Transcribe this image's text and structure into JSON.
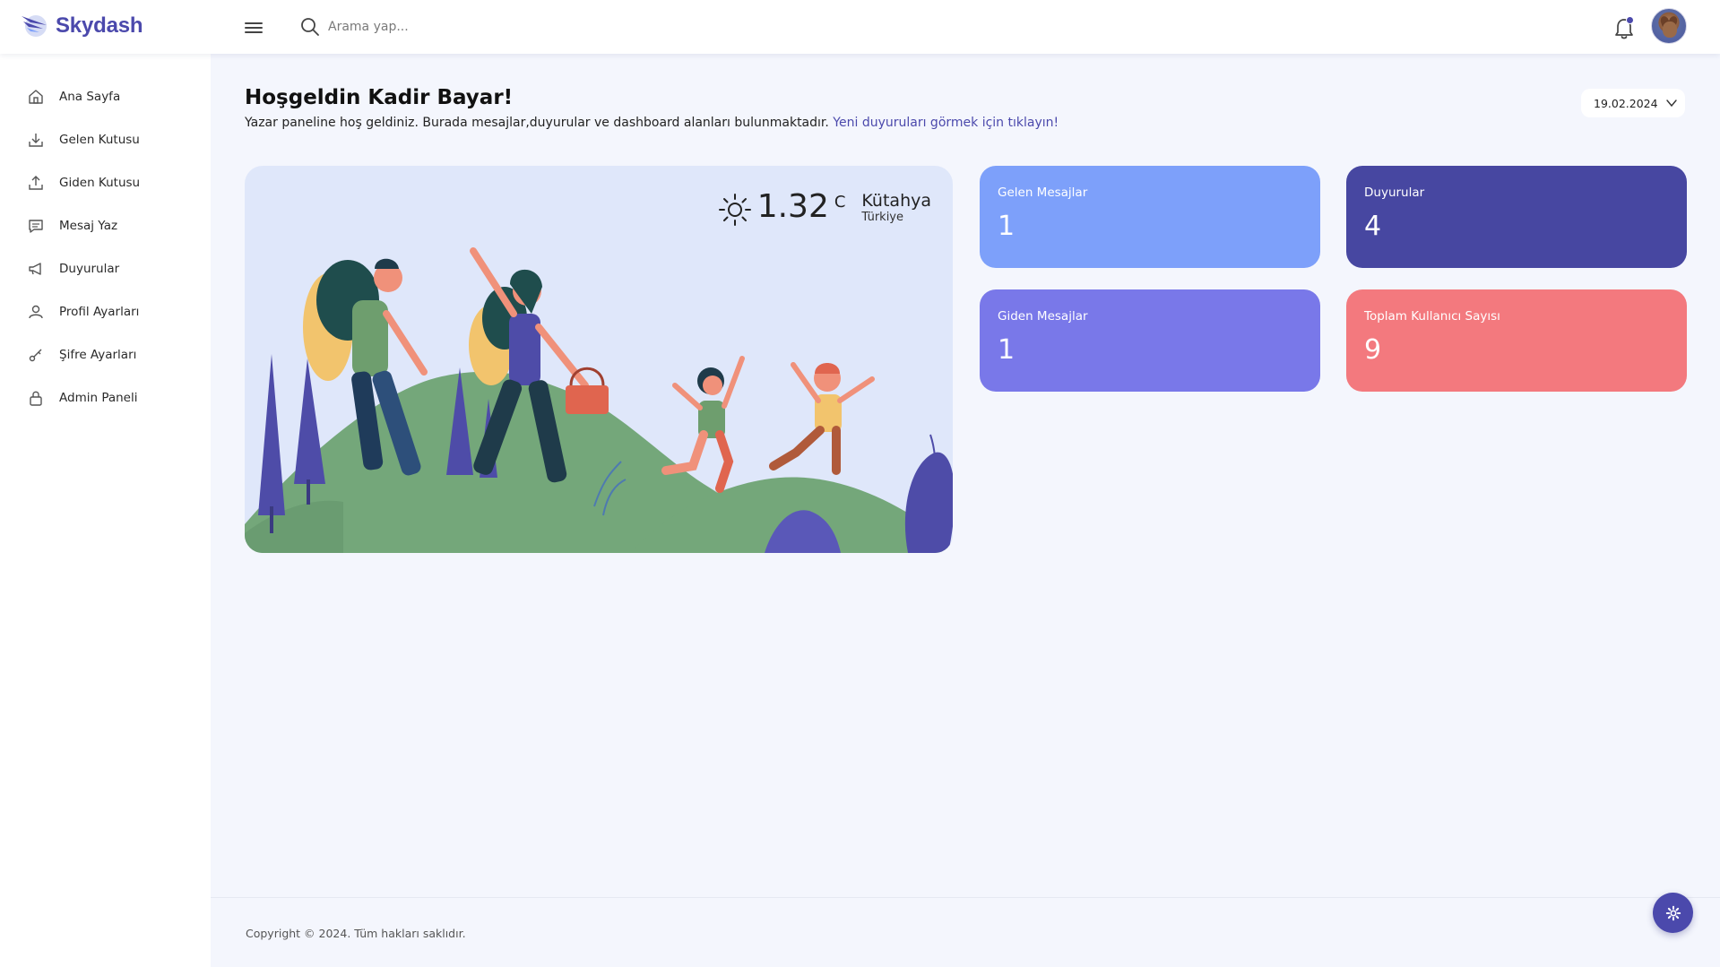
{
  "brand": {
    "name": "Skydash"
  },
  "search": {
    "placeholder": "Arama yap..."
  },
  "sidebar": {
    "items": [
      {
        "label": "Ana Sayfa",
        "icon": "home-icon"
      },
      {
        "label": "Gelen Kutusu",
        "icon": "inbox-download-icon"
      },
      {
        "label": "Giden Kutusu",
        "icon": "outbox-upload-icon"
      },
      {
        "label": "Mesaj Yaz",
        "icon": "message-icon"
      },
      {
        "label": "Duyurular",
        "icon": "megaphone-icon"
      },
      {
        "label": "Profil Ayarları",
        "icon": "user-icon"
      },
      {
        "label": "Şifre Ayarları",
        "icon": "key-icon"
      },
      {
        "label": "Admin Paneli",
        "icon": "lock-icon"
      }
    ]
  },
  "welcome": {
    "title": "Hoşgeldin Kadir Bayar!",
    "subtitle": "Yazar paneline hoş geldiniz. Burada mesajlar,duyurular ve dashboard alanları bulunmaktadır.",
    "link": "Yeni duyuruları görmek için tıklayın!"
  },
  "date_selector": {
    "value": "19.02.2024"
  },
  "weather": {
    "temperature": "1.32",
    "unit": "C",
    "city": "Kütahya",
    "country": "Türkiye",
    "icon": "sun-icon"
  },
  "stats": [
    {
      "title": "Gelen Mesajlar",
      "value": "1",
      "color": "#7da0fa"
    },
    {
      "title": "Duyurular",
      "value": "4",
      "color": "#4747a1"
    },
    {
      "title": "Giden Mesajlar",
      "value": "1",
      "color": "#7978e9"
    },
    {
      "title": "Toplam Kullanıcı Sayısı",
      "value": "9",
      "color": "#f3797e"
    }
  ],
  "footer": {
    "copyright": "Copyright © 2024. Tüm hakları saklıdır."
  },
  "colors": {
    "accent": "#4b49ac",
    "background": "#f4f6fd"
  }
}
